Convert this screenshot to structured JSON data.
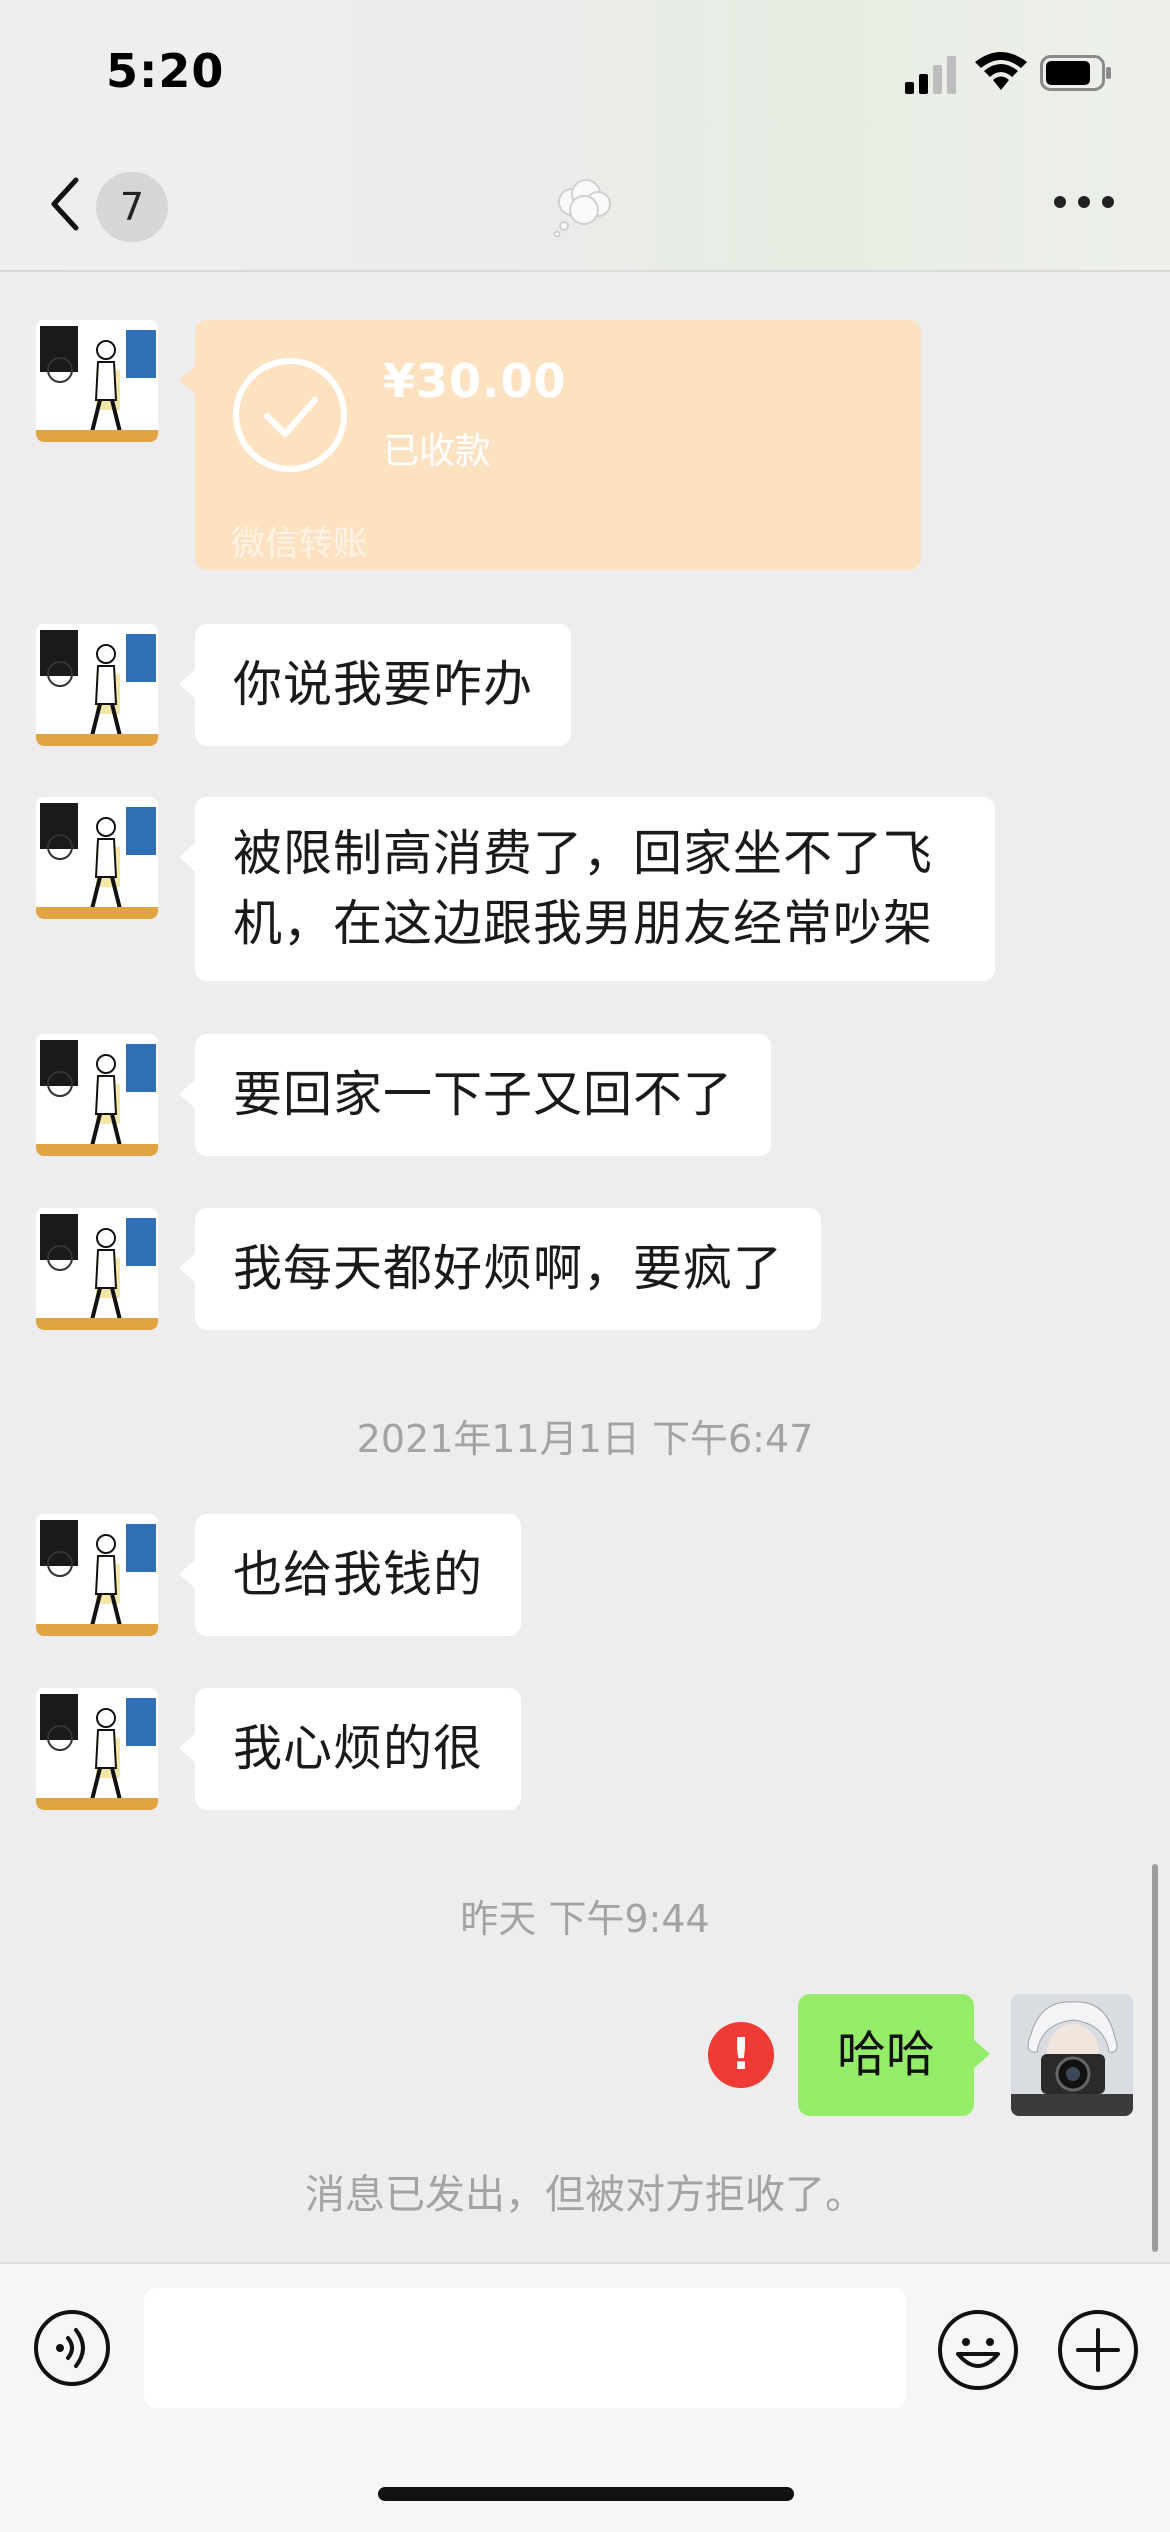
{
  "status_bar": {
    "time": "5:20"
  },
  "nav": {
    "unread_count": "7",
    "title_icon": "thought-bubble-icon"
  },
  "transfer": {
    "amount": "¥30.00",
    "status": "已收款",
    "label": "微信转账"
  },
  "messages": [
    {
      "text": "你说我要咋办"
    },
    {
      "text": "被限制高消费了，回家坐不了飞机，在这边跟我男朋友经常吵架"
    },
    {
      "text": "要回家一下子又回不了"
    },
    {
      "text": "我每天都好烦啊，要疯了"
    },
    {
      "text": "也给我钱的"
    },
    {
      "text": "我心烦的很"
    }
  ],
  "timestamps": {
    "first": "2021年11月1日 下午6:47",
    "second": "昨天 下午9:44"
  },
  "sent_message": {
    "text": "哈哈",
    "error_mark": "!",
    "rejected_note": "消息已发出，但被对方拒收了。"
  },
  "colors": {
    "sent_bubble": "#95ec69",
    "transfer_bubble": "#fde2c2",
    "error": "#f03a35"
  }
}
